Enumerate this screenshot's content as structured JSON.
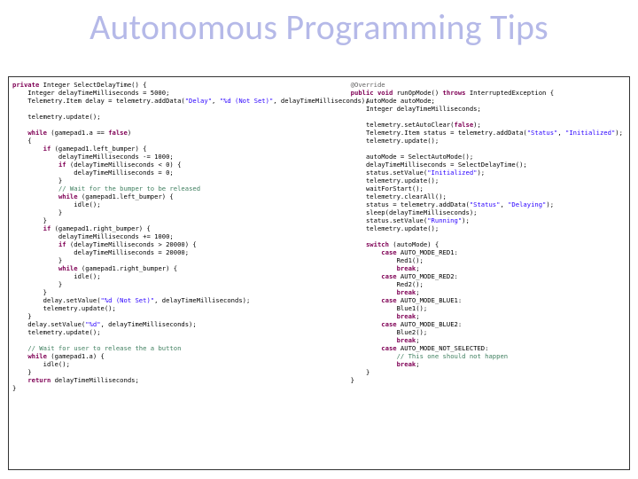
{
  "title": "Autonomous Programming Tips",
  "code_left": {
    "l1a": "private",
    "l1b": " Integer SelectDelayTime() {",
    "l2": "    Integer delayTimeMilliseconds = 5000;",
    "l3a": "    Telemetry.Item delay = telemetry.addData(",
    "l3b": "\"Delay\"",
    "l3c": ", ",
    "l3d": "\"%d (Not Set)\"",
    "l3e": ", delayTimeMilliseconds);",
    "l4": "",
    "l5": "    telemetry.update();",
    "l6": "",
    "l7a": "    ",
    "l7b": "while",
    "l7c": " (gamepad1.a == ",
    "l7d": "false",
    "l7e": ")",
    "l8": "    {",
    "l9a": "        ",
    "l9b": "if",
    "l9c": " (gamepad1.left_bumper) {",
    "l10": "            delayTimeMilliseconds -= 1000;",
    "l11a": "            ",
    "l11b": "if",
    "l11c": " (delayTimeMilliseconds < 0) {",
    "l12": "                delayTimeMilliseconds = 0;",
    "l13": "            }",
    "l14a": "            ",
    "l14b": "// Wait for the bumper to be released",
    "l15a": "            ",
    "l15b": "while",
    "l15c": " (gamepad1.left_bumper) {",
    "l16": "                idle();",
    "l17": "            }",
    "l18": "        }",
    "l19a": "        ",
    "l19b": "if",
    "l19c": " (gamepad1.right_bumper) {",
    "l20": "            delayTimeMilliseconds += 1000;",
    "l21a": "            ",
    "l21b": "if",
    "l21c": " (delayTimeMilliseconds > 20000) {",
    "l22": "                delayTimeMilliseconds = 20000;",
    "l23": "            }",
    "l24a": "            ",
    "l24b": "while",
    "l24c": " (gamepad1.right_bumper) {",
    "l25": "                idle();",
    "l26": "            }",
    "l27": "        }",
    "l28a": "        delay.setValue(",
    "l28b": "\"%d (Not Set)\"",
    "l28c": ", delayTimeMilliseconds);",
    "l29": "        telemetry.update();",
    "l30": "    }",
    "l31a": "    delay.setValue(",
    "l31b": "\"%d\"",
    "l31c": ", delayTimeMilliseconds);",
    "l32": "    telemetry.update();",
    "l33": "",
    "l34a": "    ",
    "l34b": "// Wait for user to release the a button",
    "l35a": "    ",
    "l35b": "while",
    "l35c": " (gamepad1.a) {",
    "l36": "        idle();",
    "l37": "    }",
    "l38a": "    ",
    "l38b": "return",
    "l38c": " delayTimeMilliseconds;",
    "l39": "}"
  },
  "code_right": {
    "r1": "@Override",
    "r2a": "public void",
    "r2b": " runOpMode() ",
    "r2c": "throws",
    "r2d": " InterruptedException {",
    "r3": "    AutoMode autoMode;",
    "r4": "    Integer delayTimeMilliseconds;",
    "r5": "",
    "r6a": "    telemetry.setAutoClear(",
    "r6b": "false",
    "r6c": ");",
    "r7a": "    Telemetry.Item status = telemetry.addData(",
    "r7b": "\"Status\"",
    "r7c": ", ",
    "r7d": "\"Initialized\"",
    "r7e": ");",
    "r8": "    telemetry.update();",
    "r9": "",
    "r10": "    autoMode = SelectAutoMode();",
    "r11": "    delayTimeMilliseconds = SelectDelayTime();",
    "r12a": "    status.setValue(",
    "r12b": "\"Initialized\"",
    "r12c": ");",
    "r13": "    telemetry.update();",
    "r14": "    waitForStart();",
    "r15": "    telemetry.clearAll();",
    "r16a": "    status = telemetry.addData(",
    "r16b": "\"Status\"",
    "r16c": ", ",
    "r16d": "\"Delaying\"",
    "r16e": ");",
    "r17": "    sleep(delayTimeMilliseconds);",
    "r18a": "    status.setValue(",
    "r18b": "\"Running\"",
    "r18c": ");",
    "r19": "    telemetry.update();",
    "r20": "",
    "r21a": "    ",
    "r21b": "switch",
    "r21c": " (autoMode) {",
    "r22a": "        ",
    "r22b": "case",
    "r22c": " AUTO_MODE_RED1:",
    "r23": "            Red1();",
    "r24a": "            ",
    "r24b": "break",
    "r24c": ";",
    "r25a": "        ",
    "r25b": "case",
    "r25c": " AUTO_MODE_RED2:",
    "r26": "            Red2();",
    "r27a": "            ",
    "r27b": "break",
    "r27c": ";",
    "r28a": "        ",
    "r28b": "case",
    "r28c": " AUTO_MODE_BLUE1:",
    "r29": "            Blue1();",
    "r30a": "            ",
    "r30b": "break",
    "r30c": ";",
    "r31a": "        ",
    "r31b": "case",
    "r31c": " AUTO_MODE_BLUE2:",
    "r32": "            Blue2();",
    "r33a": "            ",
    "r33b": "break",
    "r33c": ";",
    "r34a": "        ",
    "r34b": "case",
    "r34c": " AUTO_MODE_NOT_SELECTED:",
    "r35a": "            ",
    "r35b": "// This one should not happen",
    "r36a": "            ",
    "r36b": "break",
    "r36c": ";",
    "r37": "    }",
    "r38": "}"
  }
}
